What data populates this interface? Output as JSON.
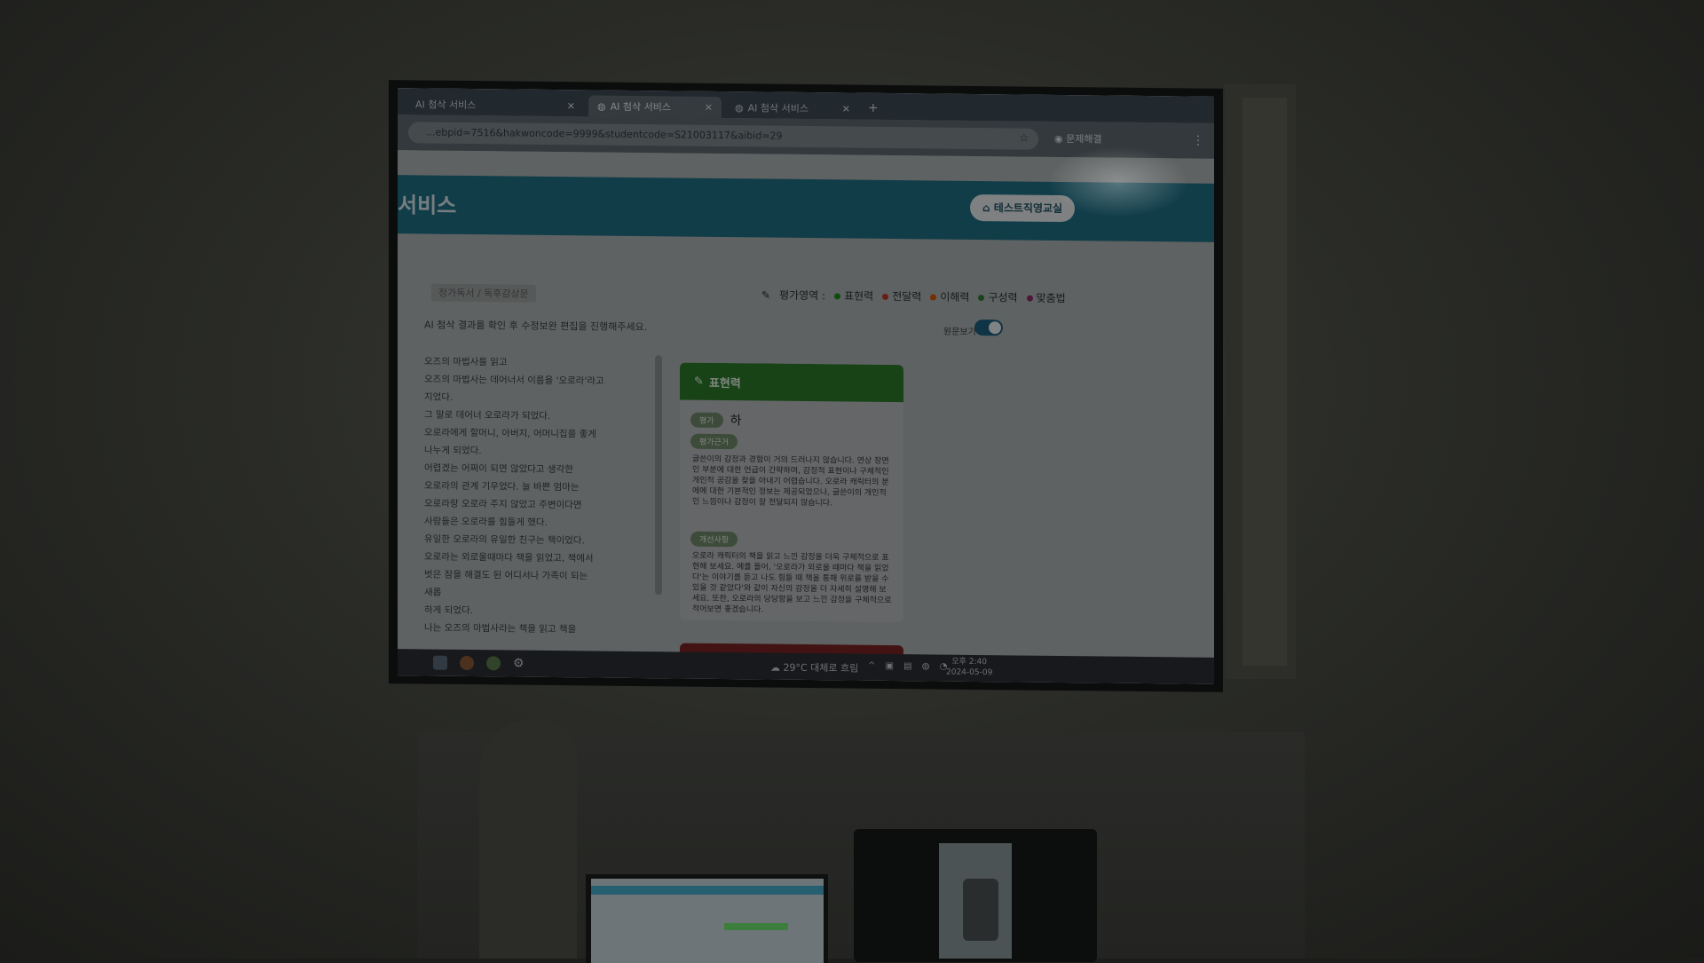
{
  "browser": {
    "tabs": [
      {
        "label": "AI 첨삭 서비스",
        "active": false
      },
      {
        "label": "AI 첨삭 서비스",
        "active": true
      },
      {
        "label": "AI 첨삭 서비스",
        "active": false
      }
    ],
    "url": "...ebpid=7516&hakwoncode=9999&studentcode=S21003117&aibid=29",
    "profile": "문제해결"
  },
  "header": {
    "title": "서비스",
    "class_button": "테스트직영교실"
  },
  "breadcrumb": "정가독서 / 독후감상문",
  "eval_areas": {
    "label": "평가영역 :",
    "items": [
      {
        "label": "표현력",
        "color": "#1a8a1a"
      },
      {
        "label": "전달력",
        "color": "#c0392b"
      },
      {
        "label": "이해력",
        "color": "#d35400"
      },
      {
        "label": "구성력",
        "color": "#2e7d32"
      },
      {
        "label": "맞춤법",
        "color": "#8e2b6b"
      }
    ]
  },
  "instruction": "AI 첨삭 결과를 확인 후 수정보완 편집을 진행해주세요.",
  "toggle_label": "원문보기",
  "essay_lines": [
    "오즈의 마법사를 읽고",
    "오즈의 마법사는 데어너서 이름을 '오로라'라고",
    "지었다.",
    "그 말로 데어너 오로라가 되었다.",
    "오로라에게 할머니, 아버지, 어머니집을 좋게",
    "나누게 되었다.",
    "어렵겠는 어쩌이 되면 않았다고 생각한",
    "오로라의 관계 기우었다. 늘 바쁜 엄마는",
    "오로라랑 오로라 주지 않았고 주변이다면",
    "사람들은 오로라를 힘들게 했다.",
    "유일한 오로라의 유일한 친구는 책이었다.",
    "오로라는 외로울때마다 책을 읽었고, 책에서",
    "벗은 잠을 해결도 된 어디서나 가족이 되는",
    "새롭",
    "하게 되었다.",
    "나는 오즈의 마법사라는 책을 읽고 책을"
  ],
  "card": {
    "title": "표현력",
    "grade_tag": "평가",
    "grade_value": "하",
    "basis_tag": "평가근거",
    "basis_text": "글쓴이의 감정과 경험이 거의 드러나지 않습니다. 연상 장면인 부분에 대한 언급이 간략하며, 감정적 표현이나 구체적인 개인적 공감을 찾을 아내기 어렵습니다. 오로라 캐릭터의 분에에 대한 기본적인 정보는 제공되었으나, 글쓴이의 개인적인 느낌이나 감정이 잘 전달되지 않습니다.",
    "improve_tag": "개선사항",
    "improve_text": "오로라 캐릭터의 책을 읽고 느낀 감정을 더욱 구체적으로 표현해 보세요. 예를 들어, '오로라가 외로울 때마다 책을 읽었다'는 이야기를 듣고 나도 힘들 때 책을 통해 위로를 받을 수 있을 것 같았다'와 같이 자신의 감정을 더 자세히 설명해 보세요. 또한, 오로라의 당당함을 보고 느낀 감정을 구체적으로 적어보면 좋겠습니다."
  },
  "taskbar": {
    "weather": "29°C 대체로 흐림",
    "time": "오후 2:40",
    "date": "2024-05-09"
  }
}
